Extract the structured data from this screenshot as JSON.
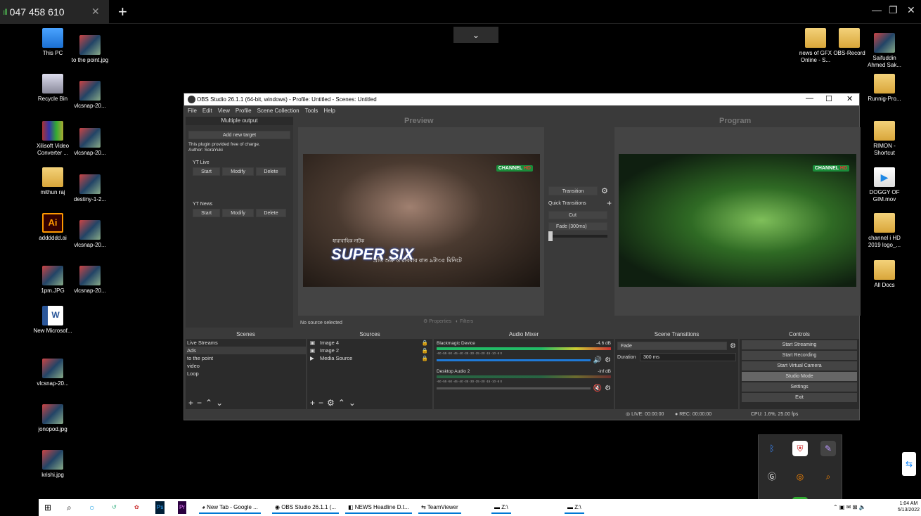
{
  "remote_tab": {
    "label": "047 458 610",
    "signal": "ıll"
  },
  "desktop_icons": [
    {
      "label": "This PC",
      "type": "pc"
    },
    {
      "label": "to the point.jpg",
      "type": "img"
    },
    {
      "label": "Recycle Bin",
      "type": "bin"
    },
    {
      "label": "vlcsnap-20...",
      "type": "img"
    },
    {
      "label": "Xilisoft Video Converter ...",
      "type": "rar"
    },
    {
      "label": "vlcsnap-20...",
      "type": "img"
    },
    {
      "label": "mithun raj",
      "type": "folder"
    },
    {
      "label": "destiny-1-2...",
      "type": "img"
    },
    {
      "label": "adddddd.ai",
      "type": "ai"
    },
    {
      "label": "vlcsnap-20...",
      "type": "img"
    },
    {
      "label": "1pm.JPG",
      "type": "img"
    },
    {
      "label": "vlcsnap-20...",
      "type": "img"
    },
    {
      "label": "New Microsof...",
      "type": "word"
    },
    {
      "label": "vlcsnap-20...",
      "type": "img"
    },
    {
      "label": "jonopod.jpg",
      "type": "img"
    },
    {
      "label": "krishi.jpg",
      "type": "img"
    },
    {
      "label": "news of GFX Online - S...",
      "type": "folder"
    },
    {
      "label": "OBS-Record",
      "type": "folder"
    },
    {
      "label": "Saifuddin Ahmed Sak...",
      "type": "img"
    },
    {
      "label": "Runnig-Pro...",
      "type": "folder"
    },
    {
      "label": "RIMON - Shortcut",
      "type": "folder"
    },
    {
      "label": "DOGGY OF GIM.mov",
      "type": "mov"
    },
    {
      "label": "channel i HD 2019 logo_...",
      "type": "folder"
    },
    {
      "label": "All Docs",
      "type": "folder"
    }
  ],
  "obs": {
    "title": "OBS Studio 26.1.1 (64-bit, windows) - Profile: Untitled - Scenes: Untitled",
    "menu": [
      "File",
      "Edit",
      "View",
      "Profile",
      "Scene Collection",
      "Tools",
      "Help"
    ],
    "multiple_output": {
      "header": "Multiple output",
      "add_target": "Add new target",
      "note1": "This plugin provided free of charge.",
      "note2": "Author: SoraYuki",
      "targets": [
        {
          "name": "YT Live",
          "start": "Start",
          "modify": "Modify",
          "delete": "Delete"
        },
        {
          "name": "YT News",
          "start": "Start",
          "modify": "Modify",
          "delete": "Delete"
        }
      ]
    },
    "preview_label": "Preview",
    "program_label": "Program",
    "preview_overlay": {
      "channel": "CHANNEL",
      "hd": "HD",
      "show_small": "ধারাবাহিক নাটক",
      "show": "SUPER SIX",
      "line": "প্রতি শুক্র ও রবিবার রাত ৯টা৩৫ মিনিটে"
    },
    "transition": {
      "button": "Transition",
      "quick": "Quick Transitions",
      "cut": "Cut",
      "fade": "Fade (300ms)"
    },
    "no_source": "No source selected",
    "properties": "Properties",
    "filters": "Filters",
    "docks": {
      "scenes": {
        "title": "Scenes",
        "items": [
          "Live Streams",
          "Ads",
          "to the point",
          "video",
          "Loop"
        ],
        "selected": 1
      },
      "sources": {
        "title": "Sources",
        "items": [
          "Image 4",
          "Image 2",
          "Media Source"
        ]
      },
      "mixer": {
        "title": "Audio Mixer",
        "channels": [
          {
            "name": "Blackmagic Device",
            "db": "-4.6 dB"
          },
          {
            "name": "Desktop Audio 2",
            "db": "-inf dB"
          }
        ],
        "scale": "-60 -55 -50 -45 -40 -35 -30 -25 -20 -15 -10 -5 0"
      },
      "transitions": {
        "title": "Scene Transitions",
        "value": "Fade",
        "duration_label": "Duration",
        "duration": "300 ms"
      },
      "controls": {
        "title": "Controls",
        "buttons": [
          "Start Streaming",
          "Start Recording",
          "Start Virtual Camera",
          "Studio Mode",
          "Settings",
          "Exit"
        ],
        "active": 3
      }
    },
    "status": {
      "live": "LIVE: 00:00:00",
      "rec": "REC: 00:00:00",
      "cpu": "CPU: 1.6%, 25.00 fps"
    }
  },
  "taskbar": {
    "items": [
      "New Tab - Google ...",
      "OBS Studio 26.1.1 (...",
      "NEWS Headline D.t...",
      "TeamViewer",
      "Z:\\",
      "Z:\\"
    ],
    "time": "1:04 AM",
    "date": "5/13/2022"
  },
  "colors": {
    "accent": "#0078d4",
    "obs_bg": "#3a3a3a"
  }
}
